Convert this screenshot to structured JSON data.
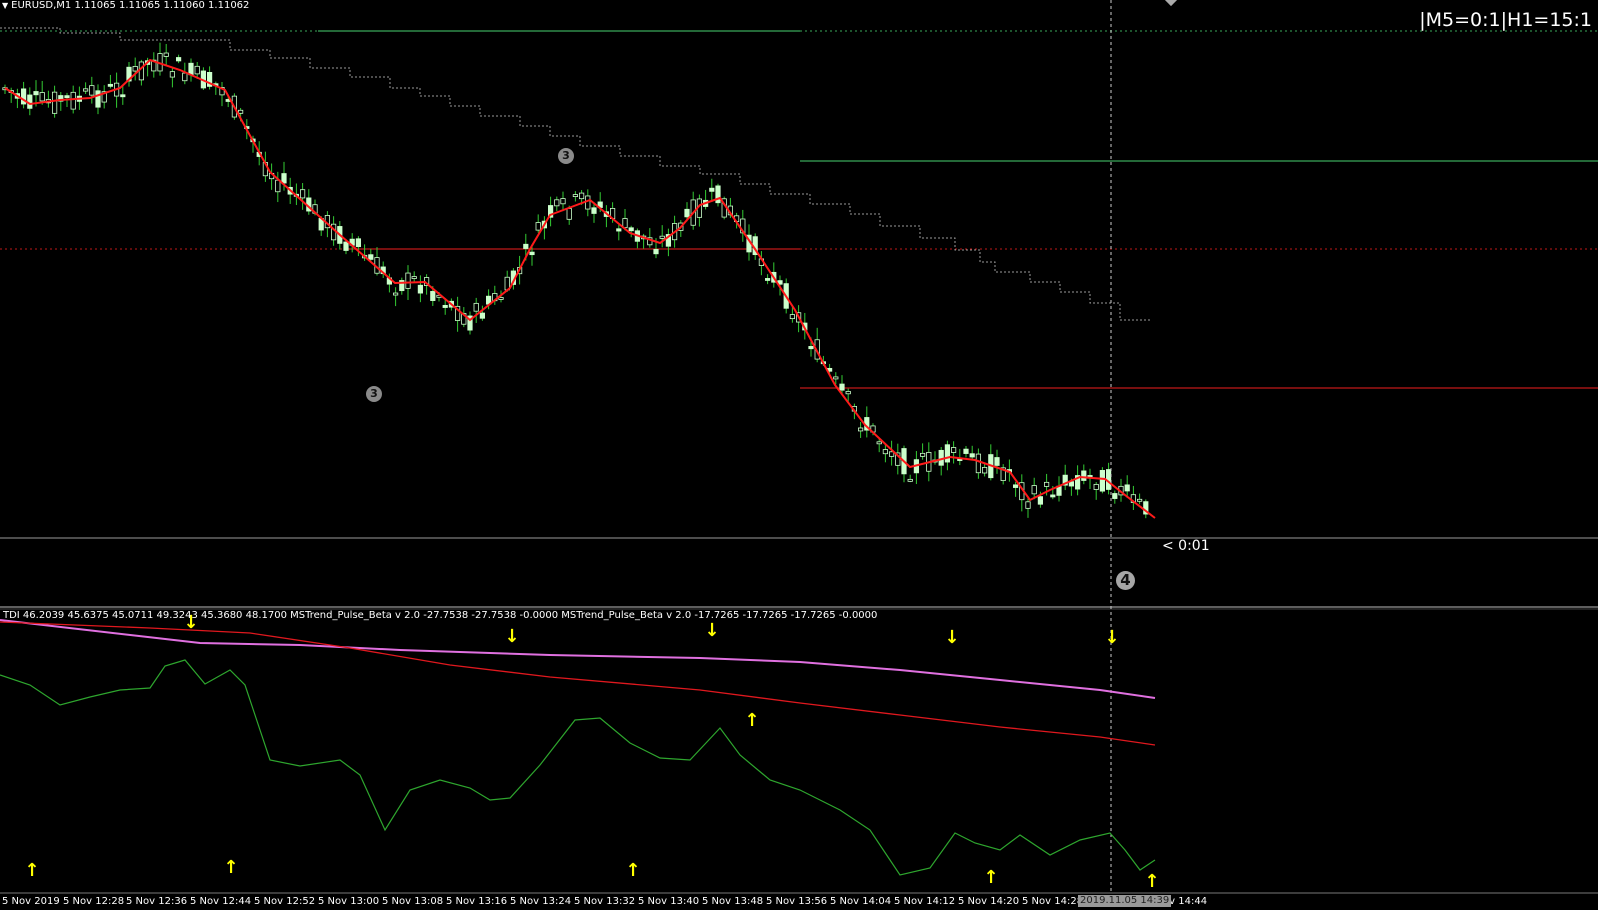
{
  "symbol_bar": {
    "text": "EURUSD,M1  1.11065 1.11065 1.11060 1.11062",
    "arrow": "▼"
  },
  "status": {
    "timeframes": "|M5=0:1|H1=15:1"
  },
  "countdown": "< 0:01",
  "zigzag_labels": {
    "low1": "3",
    "high1": "3",
    "low2": "4"
  },
  "indicator_bar": {
    "text": "TDI 46.2039 45.6375 45.0711 49.3243 45.3680 48.1700  MSTrend_Pulse_Beta v 2.0 -27.7538 -27.7538 -0.0000  MSTrend_Pulse_Beta v 2.0 -17.7265 -17.7265 -17.7265 -0.0000"
  },
  "time_axis": {
    "ticks": [
      "5 Nov 2019",
      "5 Nov 12:28",
      "5 Nov 12:36",
      "5 Nov 12:44",
      "5 Nov 12:52",
      "5 Nov 13:00",
      "5 Nov 13:08",
      "5 Nov 13:16",
      "5 Nov 13:24",
      "5 Nov 13:32",
      "5 Nov 13:40",
      "5 Nov 13:48",
      "5 Nov 13:56",
      "5 Nov 14:04",
      "5 Nov 14:12",
      "5 Nov 14:20",
      "5 Nov 14:28",
      "5 Nov 14:44"
    ],
    "cursor_time": "2019.11.05 14:39"
  },
  "colors": {
    "background": "#000000",
    "candle": "#ccffcc",
    "wick": "#33cc33",
    "zigzag": "#ff1a1a",
    "level_green": "#3aa85a",
    "level_red": "#c01818",
    "tdi_price": "#2ea62e",
    "tdi_signal": "#e0181e",
    "tdi_market": "#e070e0",
    "arrows": "#ffff00"
  },
  "arrows": {
    "down": [
      "down-arrow-icon",
      "↓"
    ],
    "up": [
      "up-arrow-icon",
      "↑"
    ]
  }
}
